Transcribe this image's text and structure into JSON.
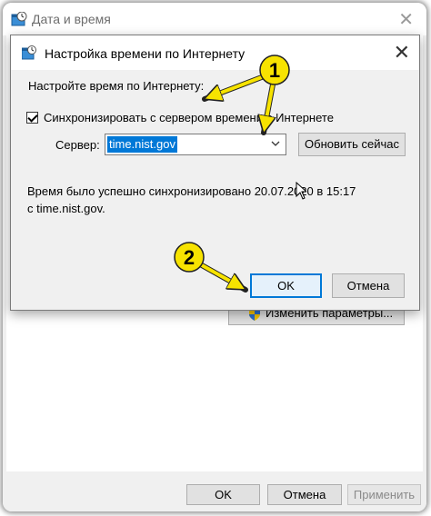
{
  "background_window": {
    "title": "Дата и время",
    "change_settings_button": "Изменить параметры...",
    "ok_button": "OK",
    "cancel_button": "Отмена",
    "apply_button": "Применить"
  },
  "dialog": {
    "title": "Настройка времени по Интернету",
    "heading": "Настройте время по Интернету:",
    "sync_checkbox": {
      "label": "Синхронизировать с сервером времени в Интернете",
      "checked": true
    },
    "server_label": "Сервер:",
    "server_value": "time.nist.gov",
    "update_button": "Обновить сейчас",
    "status_text": "Время было успешно синхронизировано 20.07.2020 в 15:17 с time.nist.gov.",
    "ok_button": "OK",
    "cancel_button": "Отмена"
  },
  "annotations": {
    "badge_1": "1",
    "badge_2": "2",
    "badge_color": "#f7e300",
    "arrow_color": "#f7e300"
  },
  "colors": {
    "accent": "#0078d7",
    "selection": "#0078d7"
  }
}
